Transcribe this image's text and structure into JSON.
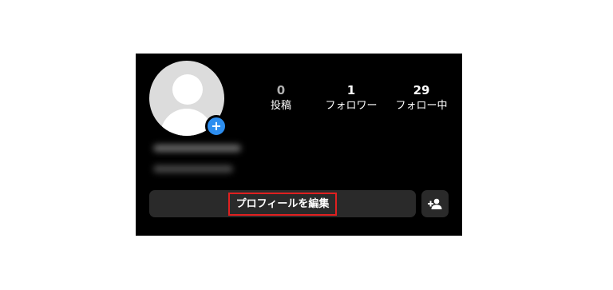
{
  "profile": {
    "avatar_icon": "default-avatar-icon",
    "add_story_icon": "plus-icon",
    "add_story_glyph": "+",
    "add_story_color": "#2d8ef0",
    "blurred_name": "",
    "blurred_bio": ""
  },
  "stats": {
    "posts": {
      "value": "0",
      "label": "投稿"
    },
    "followers": {
      "value": "1",
      "label": "フォロワー"
    },
    "following": {
      "value": "29",
      "label": "フォロー中"
    }
  },
  "actions": {
    "edit_profile_label": "プロフィールを編集",
    "highlight_color": "#e02020",
    "add_person_icon": "add-person-icon"
  },
  "theme": {
    "background": "#000000",
    "button_background": "#2a2a2a",
    "text": "#ffffff"
  }
}
